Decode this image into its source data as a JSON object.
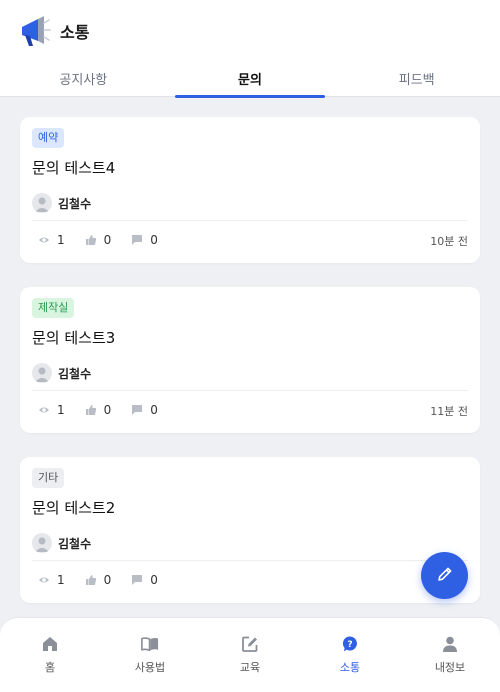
{
  "header": {
    "title": "소통",
    "logo_icon": "megaphone-icon"
  },
  "tabs": [
    {
      "label": "공지사항",
      "active": false
    },
    {
      "label": "문의",
      "active": true
    },
    {
      "label": "피드백",
      "active": false
    }
  ],
  "posts": [
    {
      "category": "예약",
      "category_bg": "#dbe6ff",
      "category_color": "#2f5fe3",
      "title": "문의 테스트4",
      "author": "김철수",
      "views": "1",
      "likes": "0",
      "comments": "0",
      "time": "10분 전"
    },
    {
      "category": "제작실",
      "category_bg": "#d9f5e0",
      "category_color": "#2a9a52",
      "title": "문의 테스트3",
      "author": "김철수",
      "views": "1",
      "likes": "0",
      "comments": "0",
      "time": "11분 전"
    },
    {
      "category": "기타",
      "category_bg": "#eceef1",
      "category_color": "#555555",
      "title": "문의 테스트2",
      "author": "김철수",
      "views": "1",
      "likes": "0",
      "comments": "0",
      "time": ""
    }
  ],
  "fab": {
    "icon": "pencil-icon"
  },
  "bottom_nav": [
    {
      "label": "홈",
      "icon": "home-icon",
      "active": false
    },
    {
      "label": "사용법",
      "icon": "book-icon",
      "active": false
    },
    {
      "label": "교육",
      "icon": "edit-square-icon",
      "active": false
    },
    {
      "label": "소통",
      "icon": "question-bubble-icon",
      "active": true
    },
    {
      "label": "내정보",
      "icon": "person-icon",
      "active": false
    }
  ],
  "colors": {
    "accent": "#2f5fe3",
    "background": "#eef0f3",
    "icon_gray": "#c4c8cf",
    "nav_gray": "#8a8f98"
  }
}
